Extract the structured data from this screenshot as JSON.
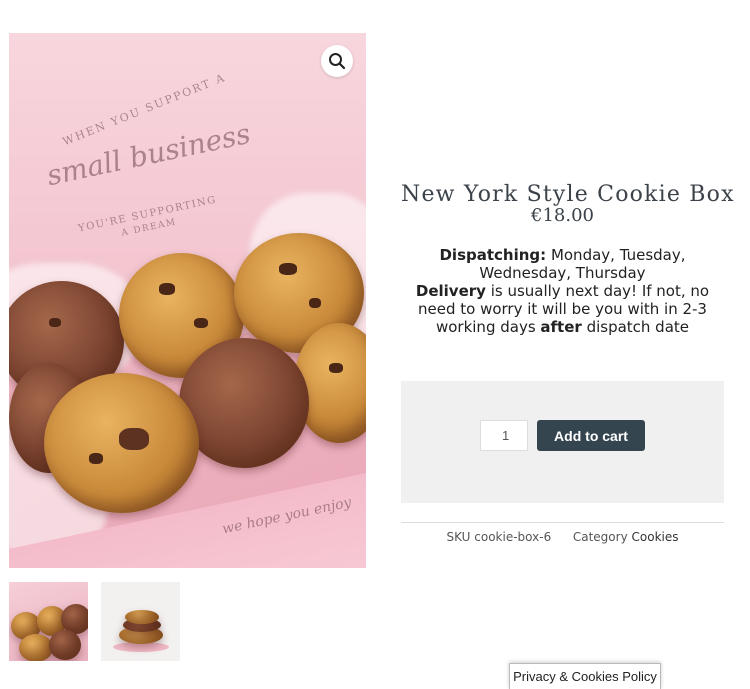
{
  "product": {
    "title": "New York Style Cookie Box",
    "price": "€18.00",
    "description": {
      "dispatching_label": "Dispatching:",
      "dispatching_text": " Monday, Tuesday, Wednesday, Thursday",
      "delivery_label": "Delivery",
      "delivery_text": " is usually next day! If not, no need to worry it will be you with in 2-3 working days ",
      "after_label": "after",
      "after_text": " dispatch date"
    },
    "image_text": {
      "line1": "WHEN YOU SUPPORT A",
      "line2": "small business",
      "line3": "YOU'RE SUPPORTING",
      "line4": "A DREAM",
      "front": "we hope you enjoy"
    }
  },
  "cart": {
    "quantity": "1",
    "add_label": "Add to cart"
  },
  "meta": {
    "sku_label": "SKU",
    "sku_value": "cookie-box-6",
    "category_label": "Category",
    "category_value": "Cookies"
  },
  "footer": {
    "privacy_label": "Privacy & Cookies Policy"
  },
  "icons": {
    "zoom": "magnifier-icon"
  },
  "colors": {
    "button_bg": "#35454f",
    "panel_bg": "#f0f0f0",
    "title": "#3b4249"
  }
}
